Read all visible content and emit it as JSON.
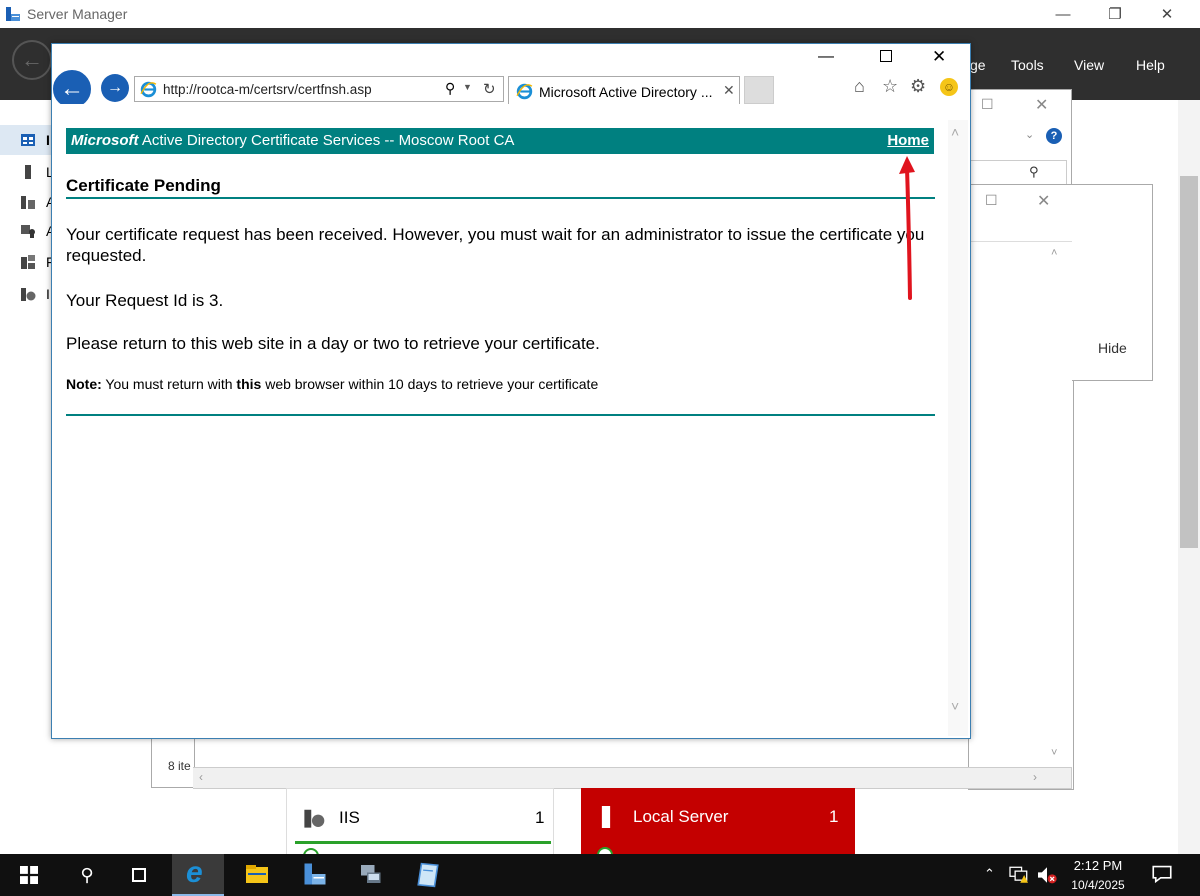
{
  "server_manager": {
    "title": "Server Manager",
    "menu": {
      "manage_partial": "ge",
      "tools": "Tools",
      "view": "View",
      "help": "Help"
    },
    "sidebar_letters": [
      "I",
      "L",
      "A",
      "A",
      "F",
      "I"
    ],
    "bg_hide_label": "Hide",
    "bg_items_partial": "8 ite",
    "tiles": [
      {
        "name": "IIS",
        "count": "1"
      },
      {
        "name": "Local Server",
        "count": "1"
      }
    ]
  },
  "ie": {
    "address_url": "http://rootca-m/certsrv/certfnsh.asp",
    "tab_title": "Microsoft Active Directory ...",
    "page": {
      "header_brand": "Microsoft",
      "header_title": "Active Directory Certificate Services  --  Moscow Root CA",
      "home_link": "Home",
      "title": "Certificate Pending",
      "paragraph1": "Your certificate request has been received. However, you must wait for an administrator to issue the certificate you requested.",
      "paragraph2": "Your Request Id is 3.",
      "paragraph3": "Please return to this web site in a day or two to retrieve your certificate.",
      "note_label": "Note:",
      "note_text_1": "You must return with",
      "note_bold": "this",
      "note_text_2": "web browser within 10 days to retrieve your certificate"
    }
  },
  "taskbar": {
    "time": "2:12 PM",
    "date": "10/4/2025"
  },
  "colors": {
    "teal": "#008080",
    "server_manager_header": "#2f2f2f",
    "local_server_tile": "#c40000",
    "annotation_arrow": "#e0141e"
  }
}
